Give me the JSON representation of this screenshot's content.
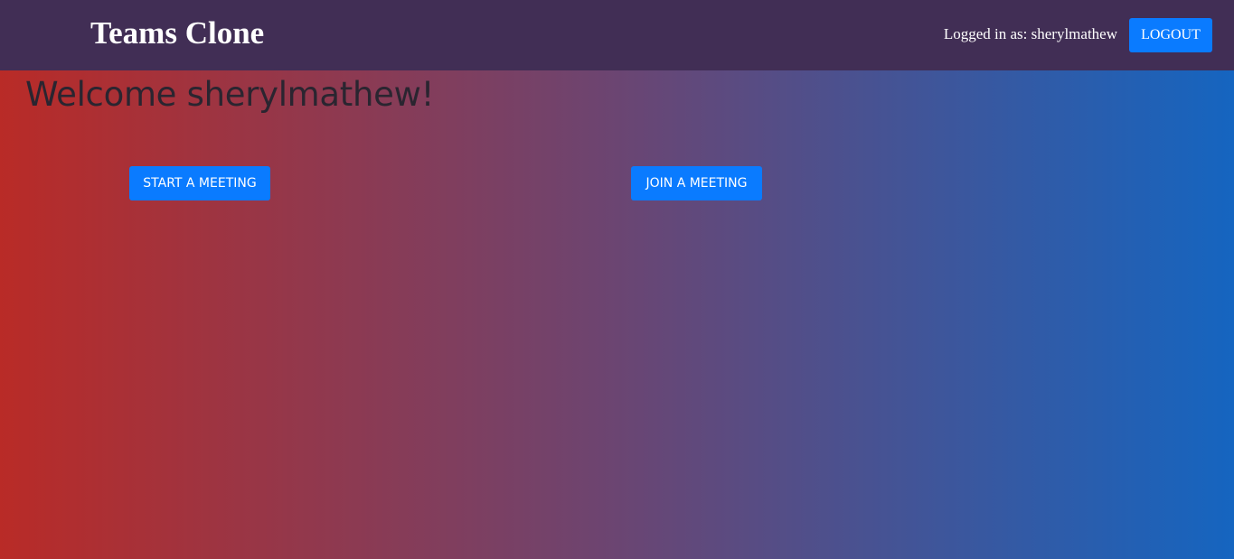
{
  "navbar": {
    "brand": "Teams Clone",
    "logged_in_text": "Logged in as: sherylmathew",
    "logout_label": "LOGOUT"
  },
  "main": {
    "welcome": "Welcome sherylmathew!",
    "start_meeting_label": "START A MEETING",
    "join_meeting_label": "JOIN A MEETING"
  },
  "colors": {
    "navbar_bg": "#412e55",
    "button_bg": "#0a7bff",
    "gradient_start": "#b92b27",
    "gradient_end": "#1565c0"
  }
}
